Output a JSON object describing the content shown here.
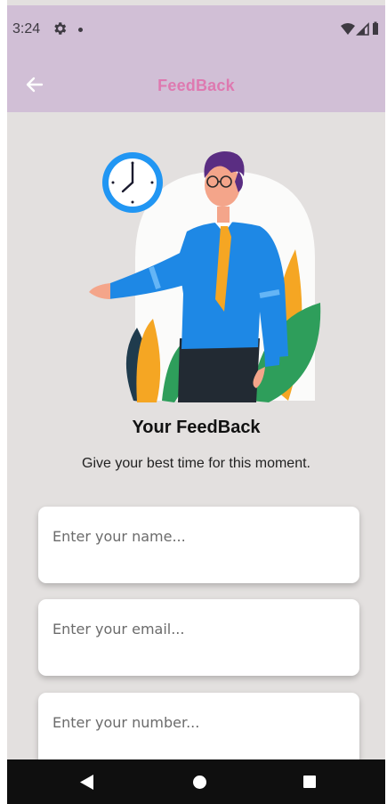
{
  "status_bar": {
    "time": "3:24",
    "icons": [
      "gear-icon",
      "notification-dot-icon",
      "wifi-icon",
      "signal-icon",
      "battery-icon"
    ]
  },
  "app_bar": {
    "title": "FeedBack",
    "back_icon": "arrow-left-icon"
  },
  "content": {
    "title": "Your FeedBack",
    "subtitle": "Give your best time for this moment."
  },
  "form": {
    "name_placeholder": "Enter your name...",
    "email_placeholder": "Enter your email...",
    "number_placeholder": "Enter your number..."
  },
  "nav_bar": {
    "icons": [
      "nav-back-icon",
      "nav-home-icon",
      "nav-recents-icon"
    ]
  },
  "colors": {
    "app_bar": "#d1bfd6",
    "title_accent": "#de79b0",
    "background": "#e3e0df",
    "field": "#ffffff",
    "nav_bar": "#0f0f0f"
  }
}
